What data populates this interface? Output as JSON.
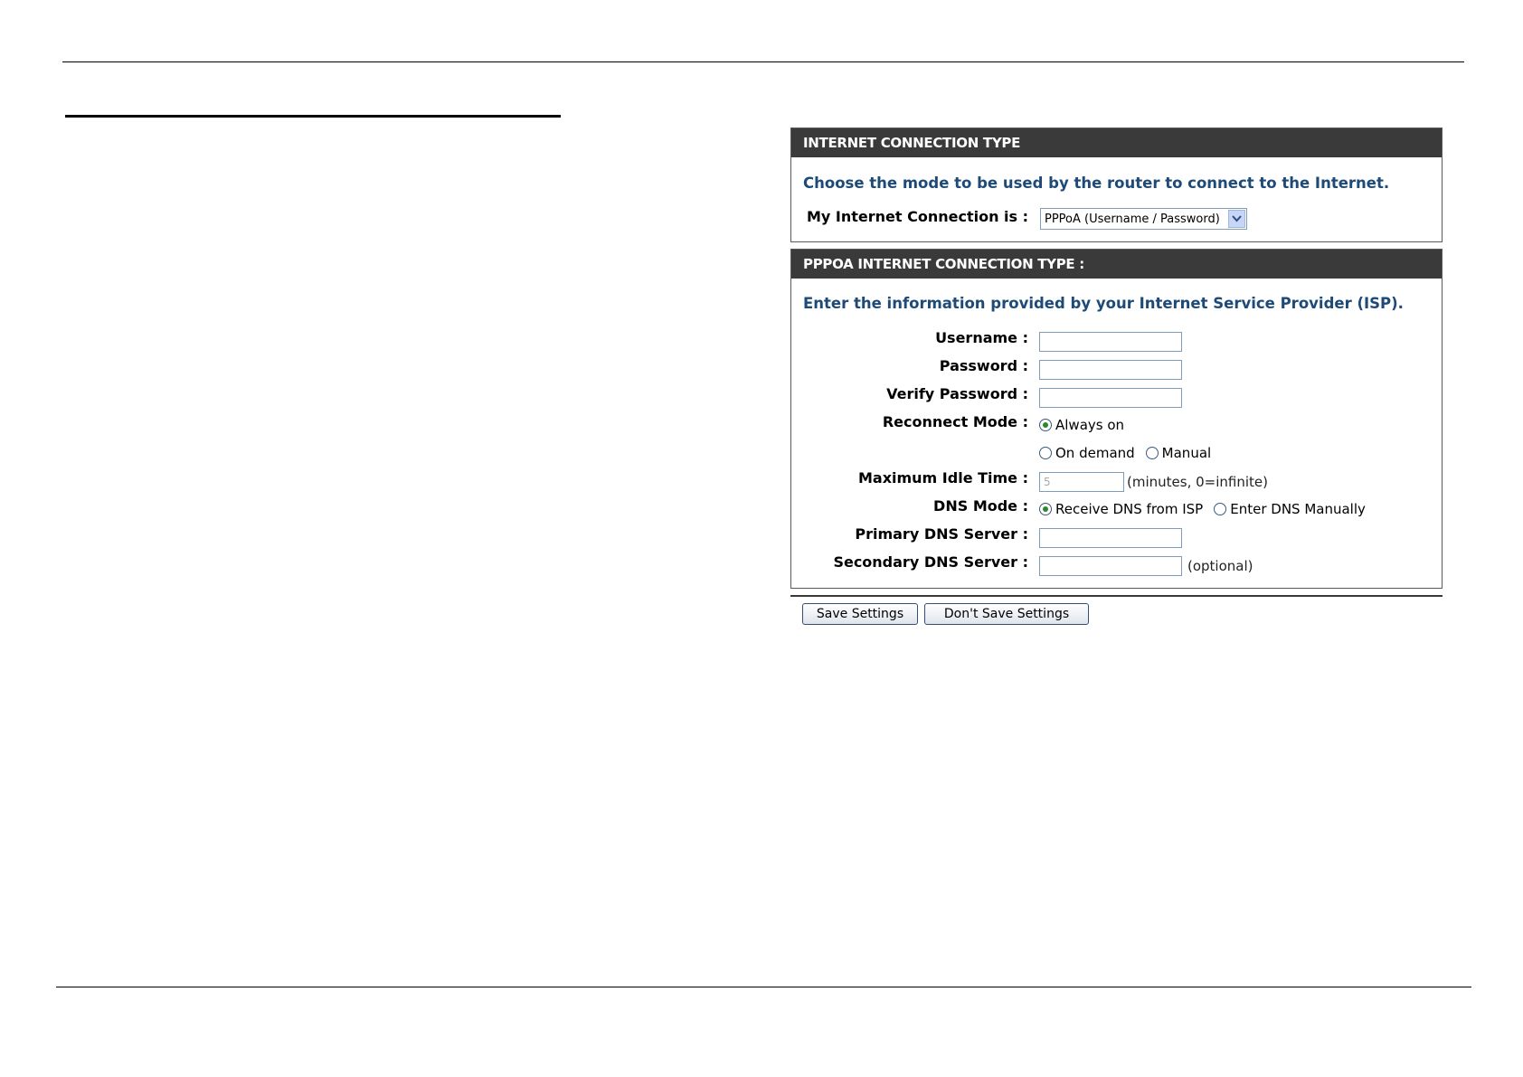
{
  "connection_type_panel": {
    "header": "INTERNET CONNECTION TYPE",
    "intro": "Choose the mode to be used by the router to connect to the Internet.",
    "connection_label": "My Internet Connection is :",
    "connection_selected": "PPPoA  (Username / Password)"
  },
  "pppoa_panel": {
    "header": "PPPOA INTERNET CONNECTION TYPE :",
    "intro": "Enter the information provided by your Internet Service Provider (ISP).",
    "username_label": "Username :",
    "username_value": "",
    "password_label": "Password :",
    "password_value": "",
    "verify_password_label": "Verify Password :",
    "verify_password_value": "",
    "reconnect_mode_label": "Reconnect Mode :",
    "reconnect_options": {
      "always_on": "Always on",
      "on_demand": "On demand",
      "manual": "Manual"
    },
    "reconnect_selected": "Always on",
    "max_idle_label": "Maximum Idle Time :",
    "max_idle_value": "5",
    "max_idle_hint": "(minutes, 0=infinite)",
    "dns_mode_label": "DNS Mode :",
    "dns_options": {
      "receive": "Receive DNS from ISP",
      "manual": "Enter DNS Manually"
    },
    "dns_selected": "Receive DNS from ISP",
    "primary_dns_label": "Primary DNS Server :",
    "primary_dns_value": "",
    "secondary_dns_label": "Secondary DNS Server :",
    "secondary_dns_value": "",
    "secondary_dns_hint": "(optional)"
  },
  "buttons": {
    "save": "Save Settings",
    "dont_save": "Don't Save Settings"
  },
  "icons": {
    "dropdown": "chevron-down-icon",
    "radio_checked": "radio-checked-icon",
    "radio_unchecked": "radio-unchecked-icon"
  },
  "colors": {
    "header_bg": "#3a3a3a",
    "intro_text": "#1e4a78",
    "radio_dot": "#2a8a2a"
  }
}
